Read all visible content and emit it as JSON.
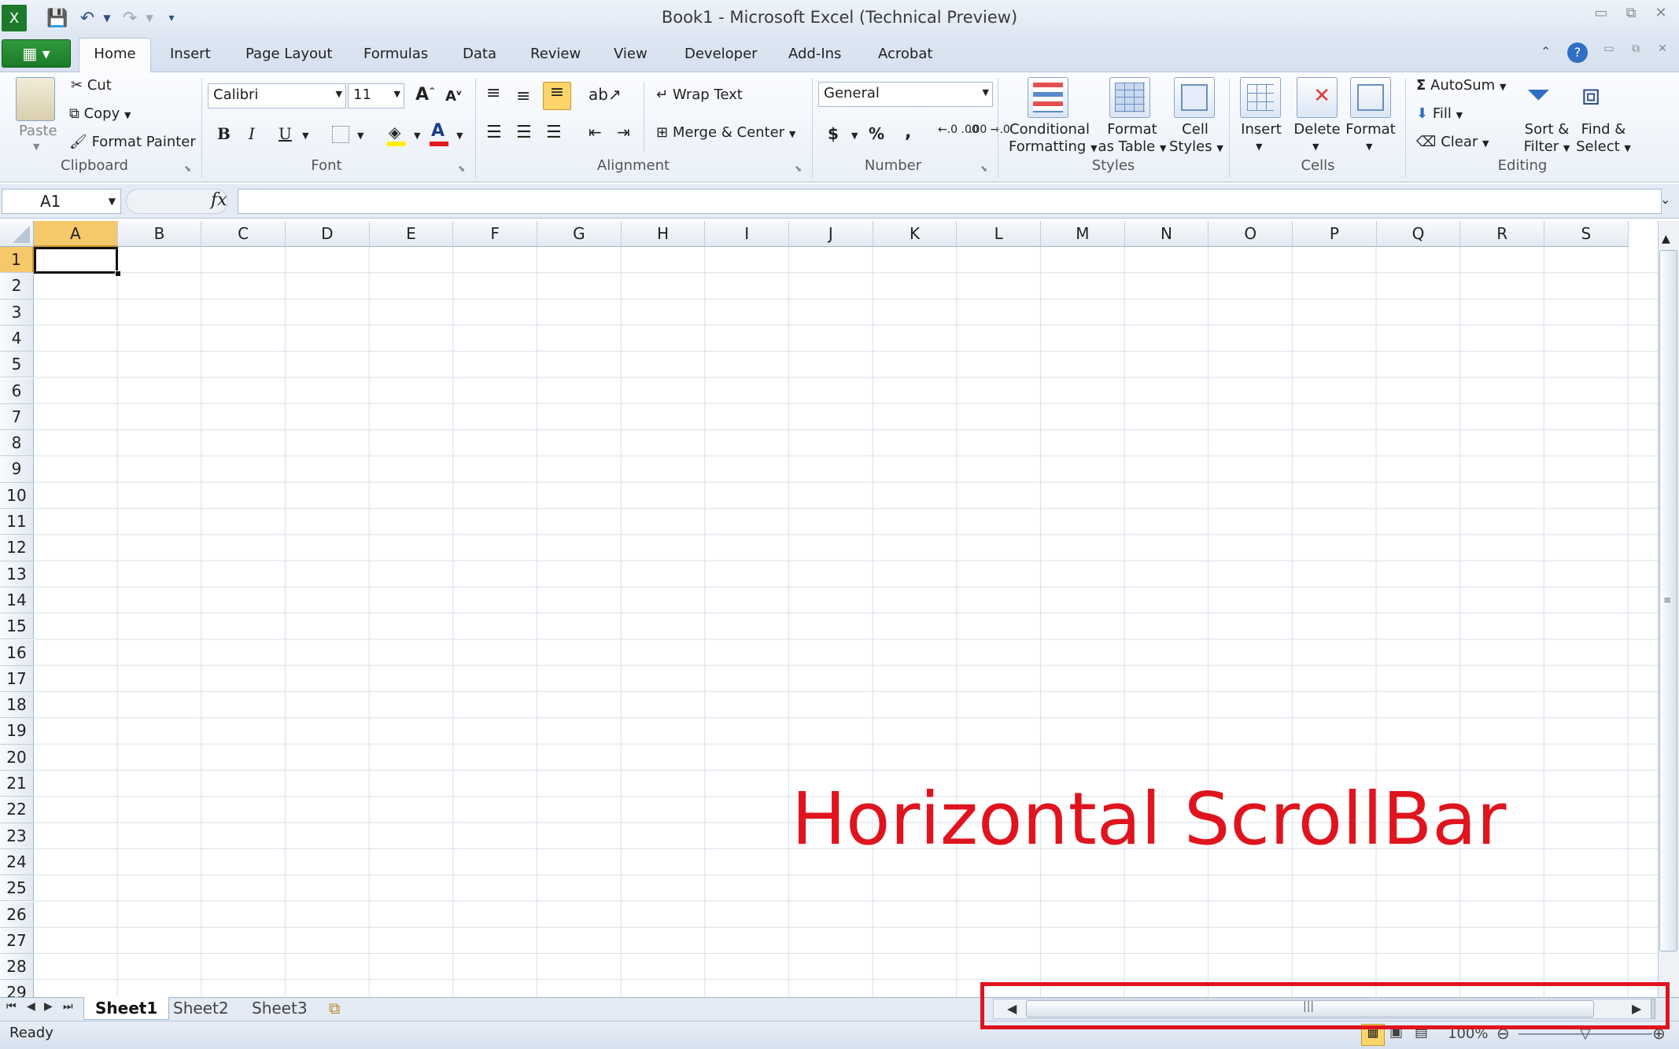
{
  "window": {
    "title": "Book1  -  Microsoft Excel (Technical Preview)",
    "controls": {
      "minimize": "▭",
      "restore": "⧉",
      "close": "✕"
    },
    "doc_controls": {
      "minimize": "▭",
      "restore": "⧉",
      "close": "✕"
    }
  },
  "quick_access": {
    "save_icon": "save-icon",
    "undo_icon": "undo-icon",
    "redo_icon": "redo-icon",
    "customize_icon": "customize-icon"
  },
  "tabs": [
    "Home",
    "Insert",
    "Page Layout",
    "Formulas",
    "Data",
    "Review",
    "View",
    "Developer",
    "Add-Ins",
    "Acrobat"
  ],
  "ribbon": {
    "clipboard": {
      "paste": "Paste",
      "cut": "Cut",
      "copy": "Copy",
      "format_painter": "Format Painter",
      "group": "Clipboard"
    },
    "font": {
      "name": "Calibri",
      "size": "11",
      "bold": "B",
      "italic": "I",
      "underline": "U",
      "grow": "A",
      "shrink": "A",
      "color": "A",
      "group": "Font"
    },
    "alignment": {
      "wrap": "Wrap Text",
      "merge": "Merge & Center",
      "group": "Alignment"
    },
    "number": {
      "format": "General",
      "currency": "$",
      "percent": "%",
      "comma": ",",
      "inc": "←.0 .00",
      "dec": ".00 →.0",
      "group": "Number"
    },
    "styles": {
      "cond1": "Conditional",
      "cond2": "Formatting",
      "fmt1": "Format",
      "fmt2": "as Table",
      "cell1": "Cell",
      "cell2": "Styles",
      "group": "Styles"
    },
    "cells": {
      "insert": "Insert",
      "delete": "Delete",
      "format": "Format",
      "group": "Cells"
    },
    "editing": {
      "autosum": "AutoSum",
      "fill": "Fill",
      "clear": "Clear",
      "sort1": "Sort &",
      "sort2": "Filter",
      "find1": "Find &",
      "find2": "Select",
      "group": "Editing"
    }
  },
  "formula_bar": {
    "name_box": "A1",
    "fx": "fx",
    "value": ""
  },
  "columns": [
    "A",
    "B",
    "C",
    "D",
    "E",
    "F",
    "G",
    "H",
    "I",
    "J",
    "K",
    "L",
    "M",
    "N",
    "O",
    "P",
    "Q",
    "R",
    "S"
  ],
  "rows": [
    "1",
    "2",
    "3",
    "4",
    "5",
    "6",
    "7",
    "8",
    "9",
    "10",
    "11",
    "12",
    "13",
    "14",
    "15",
    "16",
    "17",
    "18",
    "19",
    "20",
    "21",
    "22",
    "23",
    "24",
    "25",
    "26",
    "27",
    "28",
    "29"
  ],
  "selected_cell": "A1",
  "sheets": [
    "Sheet1",
    "Sheet2",
    "Sheet3"
  ],
  "active_sheet": "Sheet1",
  "status": {
    "ready": "Ready",
    "zoom": "100%"
  },
  "annotation": {
    "label": "Horizontal ScrollBar",
    "color": "#e0141e"
  },
  "colors": {
    "accent": "#1c7a28",
    "selection_header": "#f5c86a",
    "annotation": "#e0141e"
  }
}
